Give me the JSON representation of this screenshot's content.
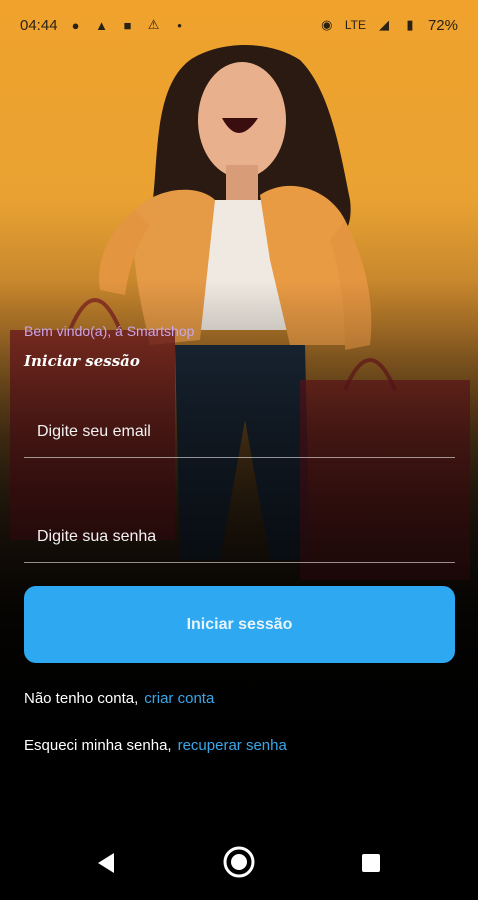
{
  "status_bar": {
    "time": "04:44",
    "left_icons": [
      "snapchat-icon",
      "a-circle-icon",
      "keyhole-icon",
      "warning-icon",
      "dot-icon"
    ],
    "right_icons": [
      "eye-icon",
      "signal-icon",
      "battery-icon"
    ],
    "network": "LTE",
    "battery": "72%"
  },
  "header": {
    "welcome": "Bem vindo(a), á Smartshop",
    "subtitle": "Iniciar sessão"
  },
  "form": {
    "email_placeholder": "Digite seu email",
    "password_placeholder": "Digite sua senha",
    "submit_label": "Iniciar sessão"
  },
  "links": {
    "no_account_text": "Não tenho conta,",
    "create_account": "criar conta",
    "forgot_text": "Esqueci minha senha,",
    "recover": "recuperar senha"
  },
  "colors": {
    "accent": "#2ea8f0",
    "link": "#3aa7e8",
    "welcome": "#c9a6e6"
  }
}
